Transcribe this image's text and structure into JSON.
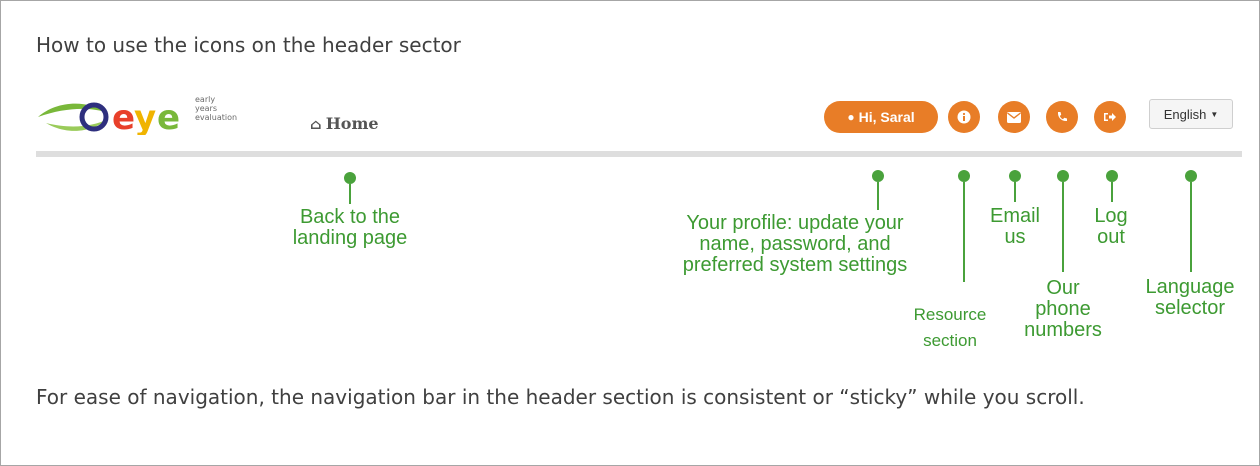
{
  "intro_text": "How to use the icons on the header sector",
  "header": {
    "logo_word": "eye",
    "logo_sub": "early\nyears\nevaluation",
    "home_label": "Home",
    "profile_label": "Hi, Saral",
    "language_label": "English"
  },
  "icons": {
    "home": "home-icon",
    "profile": "user-icon",
    "info": "info-icon",
    "email": "envelope-icon",
    "phone": "phone-icon",
    "logout": "logout-icon",
    "language": "caret-down-icon"
  },
  "annotations": {
    "home": "Back to the\nlanding page",
    "profile": "Your profile: update your\nname, password, and\npreferred system settings",
    "resource": "Resource\nsection",
    "email": "Email\nus",
    "phone": "Our\nphone\nnumbers",
    "logout": "Log\nout",
    "language": "Language\nselector"
  },
  "footer_text": "For ease of navigation, the navigation bar in the header section is consistent or “sticky” while you scroll.",
  "colors": {
    "accent_orange": "#e87d27",
    "annotation_green": "#4aa23c",
    "text_gray": "#404040"
  }
}
